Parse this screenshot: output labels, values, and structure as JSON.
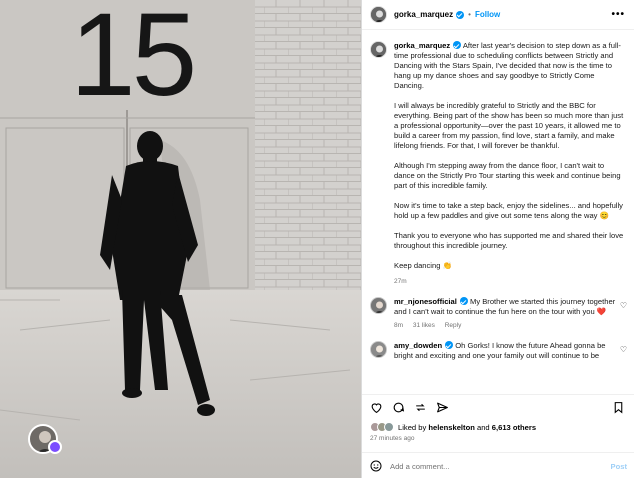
{
  "photo": {
    "door_number": "15",
    "scene": "man in dark suit walking toward large door, black and white"
  },
  "header": {
    "username": "gorka_marquez",
    "separator": "•",
    "follow_label": "Follow",
    "more_icon": "more-horizontal-icon"
  },
  "caption": {
    "username": "gorka_marquez",
    "paragraphs": [
      "After last year's decision to step down as a full-time professional due to scheduling conflicts between Strictly and Dancing with the Stars Spain, I've decided that now is the time to hang up my dance shoes and say goodbye to Strictly Come Dancing.",
      "I will always be incredibly grateful to Strictly and the BBC for everything. Being part of the show has been so much more than just a professional opportunity—over the past 10 years, it allowed me to build a career from my passion, find love, start a family, and make lifelong friends. For that, I will forever be thankful.",
      "Although I'm stepping away from the dance floor, I can't wait to dance on the Strictly Pro Tour starting this week and continue being part of this incredible family.",
      "Now it's time to take a step back, enjoy the sidelines... and hopefully hold up a few paddles and give out some tens along the way 😊",
      "Thank you to everyone who has supported me and shared their love throughout this incredible journey.",
      "Keep dancing 👏"
    ],
    "time": "27m"
  },
  "comments": [
    {
      "username": "mr_njonesofficial",
      "text": "My Brother we started this journey together and I can't wait to continue the fun here on the tour with you ❤️",
      "time": "8m",
      "likes": "31 likes",
      "reply": "Reply"
    },
    {
      "username": "amy_dowden",
      "text": "Oh Gorks! I know the future Ahead gonna be bright and exciting and one your family out will continue to be",
      "time": "",
      "likes": "",
      "reply": ""
    }
  ],
  "actions": {
    "likes_prefix": "Liked by ",
    "liked_by": "helenskelton",
    "likes_middle": " and ",
    "likes_count": "6,613 others",
    "posted": "27 minutes ago",
    "add_comment_placeholder": "Add a comment...",
    "post_label": "Post"
  },
  "colors": {
    "accent": "#0095f6",
    "badge": "#7b4dff"
  }
}
